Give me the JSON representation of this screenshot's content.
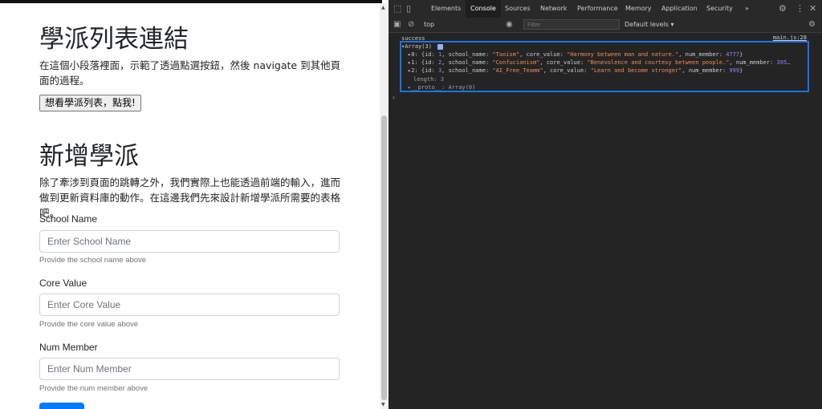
{
  "page": {
    "heading1": "學派列表連結",
    "paragraph1": "在這個小段落裡面，示範了透過點選按鈕，然後 navigate 到其他頁面的過程。",
    "button_label": "想看學派列表，點我!",
    "heading2": "新增學派",
    "paragraph2": "除了牽涉到頁面的跳轉之外，我們實際上也能透過前端的輸入，進而做到更新資料庫的動作。在這邊我們先來設計新增學派所需要的表格吧。",
    "form": {
      "school_name": {
        "label": "School Name",
        "placeholder": "Enter School Name",
        "help": "Provide the school name above"
      },
      "core_value": {
        "label": "Core Value",
        "placeholder": "Enter Core Value",
        "help": "Provide the core value above"
      },
      "num_member": {
        "label": "Num Member",
        "placeholder": "Enter Num Member",
        "help": "Provide the num member above"
      }
    }
  },
  "devtools": {
    "tabs": [
      "Elements",
      "Console",
      "Sources",
      "Network",
      "Performance",
      "Memory",
      "Application",
      "Security"
    ],
    "active_tab": "Console",
    "more_tabs": "»",
    "context": "top",
    "filter_placeholder": "Filter",
    "levels": "Default levels ▾",
    "console": {
      "log_text": "success",
      "log_source": "main.js:28",
      "array_header": "▾Array(3)",
      "rows": [
        {
          "idx": "▸0: {id: ",
          "id": "1",
          "p1": ", school_name: ",
          "name": "\"Taoism\"",
          "p2": ", core_value: ",
          "value": "\"Harmony between man and nature.\"",
          "p3": ", num_member: ",
          "num": "4777",
          "end": "}"
        },
        {
          "idx": "▸1: {id: ",
          "id": "2",
          "p1": ", school_name: ",
          "name": "\"Confucianism\"",
          "p2": ", core_value: ",
          "value": "\"Benevolence and courtesy between people.\"",
          "p3": ", num_member: ",
          "num": "395…",
          "end": ""
        },
        {
          "idx": "▸2: {id: ",
          "id": "3",
          "p1": ", school_name: ",
          "name": "\"AI_Free_Teamm\"",
          "p2": ", core_value: ",
          "value": "\"Learn and become stronger\"",
          "p3": ", num_member: ",
          "num": "999",
          "end": "}"
        }
      ],
      "length_label": "length: ",
      "length_value": "3",
      "proto_label": "▸__proto__: Array(0)",
      "prompt": "›"
    }
  }
}
